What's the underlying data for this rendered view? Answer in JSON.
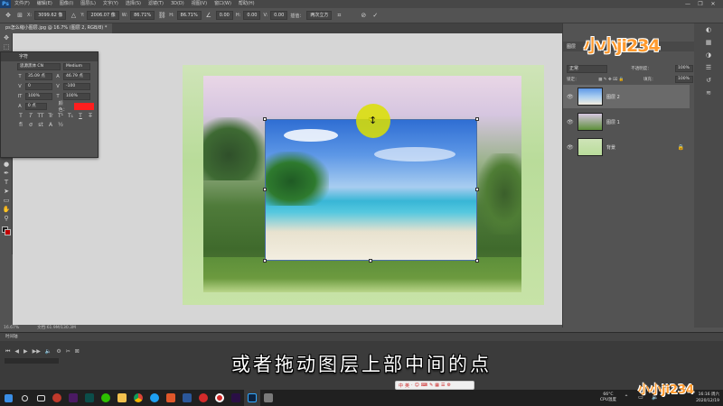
{
  "app": {
    "menu": [
      "文件(F)",
      "编辑(E)",
      "图像(I)",
      "图层(L)",
      "文字(Y)",
      "选择(S)",
      "滤镜(T)",
      "3D(D)",
      "视图(V)",
      "窗口(W)",
      "帮助(H)"
    ],
    "window_controls": [
      "—",
      "❐",
      "✕"
    ]
  },
  "options": {
    "x_label": "X:",
    "x_value": "3099.62 像",
    "y_label": "Y:",
    "y_value": "2006.07 像",
    "w_label": "W:",
    "w_value": "86.71%",
    "h_label": "H:",
    "h_value": "86.71%",
    "angle_value": "0.00",
    "hskew_label": "H:",
    "hskew_value": "0.00",
    "vskew_label": "V:",
    "vskew_value": "0.00",
    "interp_label": "插值：",
    "interp_value": "两次立方"
  },
  "tab": {
    "label": "ps怎么缩小图层.jpg @ 16.7% (图层 2, RGB/8) *"
  },
  "char_panel": {
    "title": "字符",
    "font_family": "思源黑体 CN",
    "font_style": "Medium",
    "font_size": "35.09 点",
    "leading": "46.79 点",
    "kerning": "0",
    "tracking": "-100",
    "vscale": "100%",
    "hscale": "100%",
    "baseline": "0 点",
    "color_label": "颜色：",
    "color": "#ff1e1e",
    "buttons": [
      "T",
      "T",
      "TT",
      "Tr",
      "T¹",
      "T₁",
      "T",
      "T̶"
    ]
  },
  "layers": {
    "tab_label": "图层",
    "blend_mode": "正常",
    "opacity_label": "不透明度：",
    "opacity_value": "100%",
    "lock_label": "锁定：",
    "fill_label": "填充：",
    "fill_value": "100%",
    "items": [
      {
        "name": "图层 2",
        "selected": true
      },
      {
        "name": "图层 1",
        "selected": false
      },
      {
        "name": "背景",
        "selected": false
      }
    ]
  },
  "status": {
    "zoom": "16.67%",
    "doc": "文档:61.9M/130.3M"
  },
  "timeline": {
    "title": "时间轴"
  },
  "subtitle": "或者拖动图层上部中间的点",
  "watermark": "小小ji234",
  "taskbar": {
    "weather_temp": "66°C",
    "weather_label": "CPU温度",
    "time": "16:16 周六",
    "date": "2020/12/19"
  },
  "ime_icons": [
    "中",
    "英",
    "·",
    "☺",
    "⌨",
    "✎",
    "▦",
    "☰",
    "⚙"
  ]
}
